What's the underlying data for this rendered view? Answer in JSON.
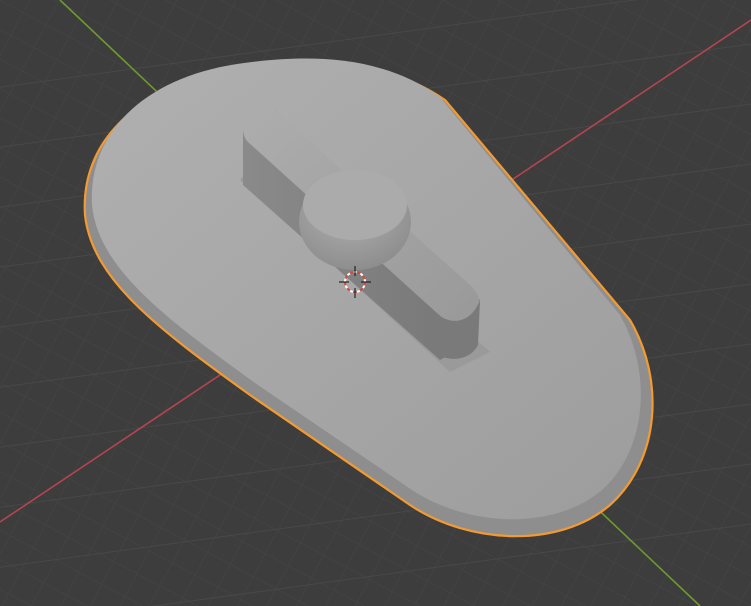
{
  "viewport": {
    "view": "3d-viewport",
    "shading": "solid",
    "background_color": "#3d3d3d",
    "grid_color": "#4a4a4a",
    "x_axis_color": "#b5454f",
    "y_axis_color": "#6f9a2e",
    "selection_outline_color": "#f39a31",
    "object_color": "#a6a6a6",
    "selected_object": "base-plate-with-wing-knob",
    "cursor_icon": "3d-cursor-icon"
  }
}
